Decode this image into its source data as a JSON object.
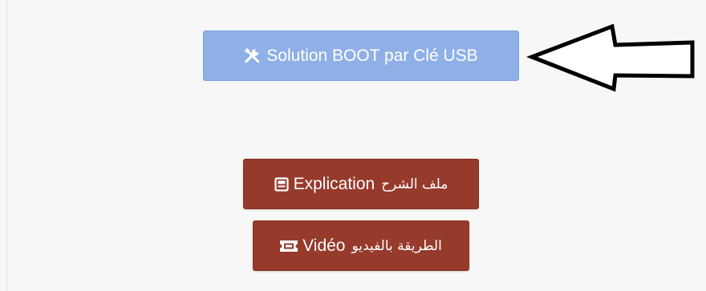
{
  "buttons": {
    "usb": {
      "label": "Solution BOOT par Clé USB",
      "icon": "tools-icon",
      "color": "#8fb0e6"
    },
    "explication": {
      "label": "Explication",
      "arabic_label": "ملف الشرح",
      "icon": "document-icon",
      "color": "#963a2c"
    },
    "video": {
      "label": "Vidéo",
      "arabic_label": "الطريقة بالفيديو",
      "icon": "ticket-icon",
      "color": "#963a2c"
    }
  },
  "annotation": {
    "icon": "left-arrow-icon",
    "color": "#000000"
  }
}
